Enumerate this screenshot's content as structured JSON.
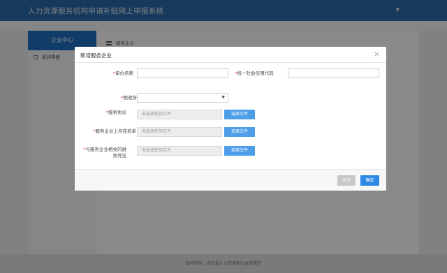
{
  "header": {
    "title": "人力资源服务机构申请补贴网上申报系统"
  },
  "sidebar": {
    "heading": "企业中心",
    "items": [
      {
        "label": "我的申报"
      }
    ]
  },
  "breadcrumb": {
    "text": "服务企业"
  },
  "footer": {
    "text": "版权所有：湖北省人力资源和社会保障厅"
  },
  "modal": {
    "title": "新增服务企业",
    "close_symbol": "×",
    "required_mark": "*",
    "fields": {
      "unit_name": {
        "label": "单位名称",
        "value": ""
      },
      "credit_code": {
        "label": "统一社会信用代码",
        "value": ""
      },
      "location": {
        "label": "税收所在地",
        "value": ""
      },
      "agreement": {
        "label": "服务协议",
        "placeholder": "未选择任何文件",
        "button": "选择文件"
      },
      "roster": {
        "label": "服务企业上月花名单",
        "placeholder": "未选择任何文件",
        "button": "选择文件"
      },
      "financial": {
        "label": "与服务企业相关的财务凭证",
        "placeholder": "未选择任何文件",
        "button": "选择文件"
      }
    },
    "buttons": {
      "close": "关闭",
      "confirm": "确定"
    }
  }
}
